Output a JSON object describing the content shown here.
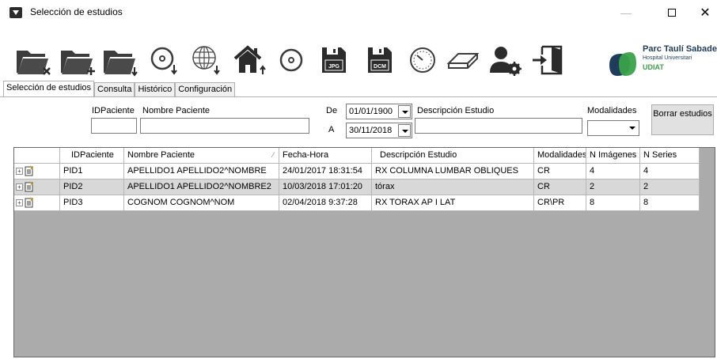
{
  "window": {
    "title": "Selección de estudios",
    "controls": {
      "minimize": "—",
      "close": "✕"
    }
  },
  "toolbar": {
    "buttons": [
      {
        "name": "folder-remove-icon"
      },
      {
        "name": "folder-add-icon"
      },
      {
        "name": "folder-download-icon"
      },
      {
        "name": "disc-download-icon"
      },
      {
        "name": "globe-download-icon"
      },
      {
        "name": "home-upload-icon"
      },
      {
        "name": "disc-icon"
      },
      {
        "name": "save-jpg-icon",
        "text": "JPG"
      },
      {
        "name": "save-dcm-icon",
        "text": "DCM"
      },
      {
        "name": "gauge-icon"
      },
      {
        "name": "eraser-icon"
      },
      {
        "name": "user-settings-icon"
      },
      {
        "name": "exit-door-icon"
      }
    ]
  },
  "logo": {
    "line1": "Parc Taulí Sabadell",
    "line2": "Hospital Universitari",
    "line3": "UDIAT"
  },
  "tabs": [
    "Selección de estudios",
    "Consulta",
    "Histórico",
    "Configuración"
  ],
  "filters": {
    "id_label": "IDPaciente",
    "id_value": "",
    "name_label": "Nombre Paciente",
    "name_value": "",
    "from_label": "De",
    "from_date": "01/01/1900",
    "to_label": "A",
    "to_date": "30/11/2018",
    "desc_label": "Descripción Estudio",
    "desc_value": "",
    "mod_label": "Modalidades",
    "mod_value": "",
    "clear_button": "Borrar estudios"
  },
  "grid": {
    "columns": [
      "",
      "IDPaciente",
      "Nombre Paciente",
      "Fecha-Hora",
      "Descripción Estudio",
      "Modalidades",
      "N Imágenes",
      "N Series"
    ],
    "sort_glyph": "⁄",
    "rows": [
      [
        "",
        "PID1",
        "APELLIDO1 APELLIDO2^NOMBRE",
        "24/01/2017 18:31:54",
        "RX COLUMNA LUMBAR OBLIQUES",
        "CR",
        "4",
        "4"
      ],
      [
        "",
        "PID2",
        "APELLIDO1 APELLIDO2^NOMBRE2",
        "10/03/2018 17:01:20",
        "tórax",
        "CR",
        "2",
        "2"
      ],
      [
        "",
        "PID3",
        "COGNOM COGNOM^NOM",
        "02/04/2018 9:37:28",
        "RX TORAX AP I LAT",
        "CR\\PR",
        "8",
        "8"
      ]
    ],
    "expander_glyph": "+"
  },
  "colors": {
    "grid_background": "#ababab",
    "row_alt": "#d8d8d8",
    "logo_blue": "#1f3d5a",
    "logo_green": "#3aa24a",
    "icon_dark": "#3c3c3c"
  }
}
